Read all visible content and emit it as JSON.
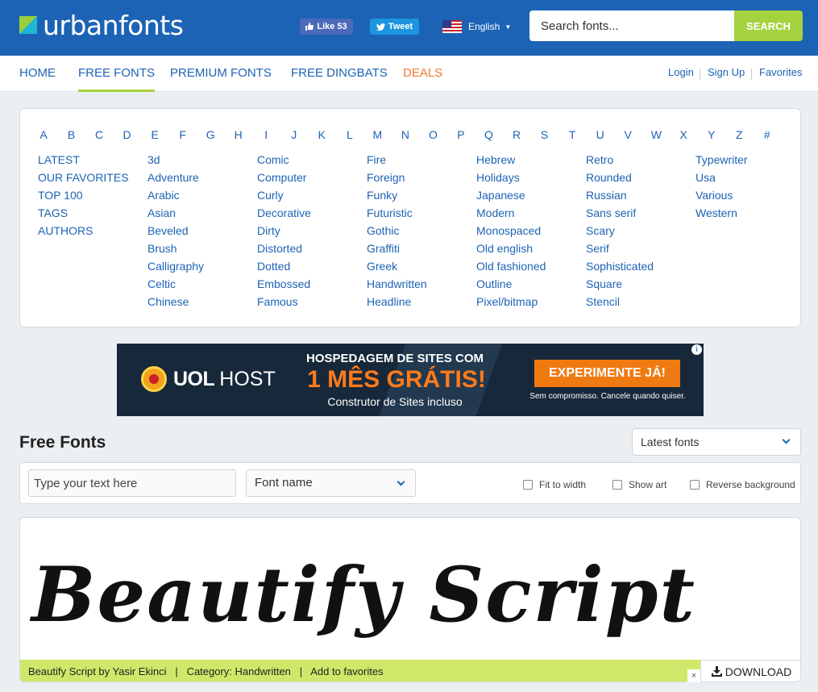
{
  "header": {
    "logo_text": "urbanfonts",
    "like_label": "Like 53",
    "tweet_label": "Tweet",
    "language": "English",
    "search_placeholder": "Search fonts...",
    "search_button": "SEARCH"
  },
  "nav": {
    "items": [
      "HOME",
      "FREE FONTS",
      "PREMIUM FONTS",
      "FREE DINGBATS",
      "DEALS"
    ],
    "active": "FREE FONTS",
    "right": [
      "Login",
      "Sign Up",
      "Favorites"
    ]
  },
  "letters": [
    "A",
    "B",
    "C",
    "D",
    "E",
    "F",
    "G",
    "H",
    "I",
    "J",
    "K",
    "L",
    "M",
    "N",
    "O",
    "P",
    "Q",
    "R",
    "S",
    "T",
    "U",
    "V",
    "W",
    "X",
    "Y",
    "Z",
    "#"
  ],
  "categories": {
    "col0": [
      "LATEST",
      "OUR FAVORITES",
      "TOP 100",
      "TAGS",
      "AUTHORS"
    ],
    "col1": [
      "3d",
      "Adventure",
      "Arabic",
      "Asian",
      "Beveled",
      "Brush",
      "Calligraphy",
      "Celtic",
      "Chinese"
    ],
    "col2": [
      "Comic",
      "Computer",
      "Curly",
      "Decorative",
      "Dirty",
      "Distorted",
      "Dotted",
      "Embossed",
      "Famous"
    ],
    "col3": [
      "Fire",
      "Foreign",
      "Funky",
      "Futuristic",
      "Gothic",
      "Graffiti",
      "Greek",
      "Handwritten",
      "Headline"
    ],
    "col4": [
      "Hebrew",
      "Holidays",
      "Japanese",
      "Modern",
      "Monospaced",
      "Old english",
      "Old fashioned",
      "Outline",
      "Pixel/bitmap"
    ],
    "col5": [
      "Retro",
      "Rounded",
      "Russian",
      "Sans serif",
      "Scary",
      "Serif",
      "Sophisticated",
      "Square",
      "Stencil"
    ],
    "col6": [
      "Typewriter",
      "Usa",
      "Various",
      "Western"
    ]
  },
  "ad": {
    "brand": "UOL",
    "host": "HOST",
    "headline1": "HOSPEDAGEM DE SITES COM",
    "headline2": "1 MÊS GRÁTIS!",
    "headline3": "Construtor de Sites incluso",
    "cta": "EXPERIMENTE JÁ!",
    "note": "Sem compromisso. Cancele quando quiser."
  },
  "listing": {
    "title": "Free Fonts",
    "sort_value": "Latest fonts",
    "text_placeholder": "Type your text here",
    "fontname_value": "Font name",
    "checkboxes": [
      "Fit to width",
      "Show art",
      "Reverse background"
    ]
  },
  "font_card": {
    "preview_text": "Beautify Script",
    "name_author": "Beautify Script by Yasir Ekinci",
    "category": "Category: Handwritten",
    "favorites": "Add to favorites",
    "download": "DOWNLOAD"
  },
  "colors": {
    "brand_blue": "#1d63b5",
    "accent_green": "#a5d23f",
    "deals_orange": "#f07a2e"
  }
}
